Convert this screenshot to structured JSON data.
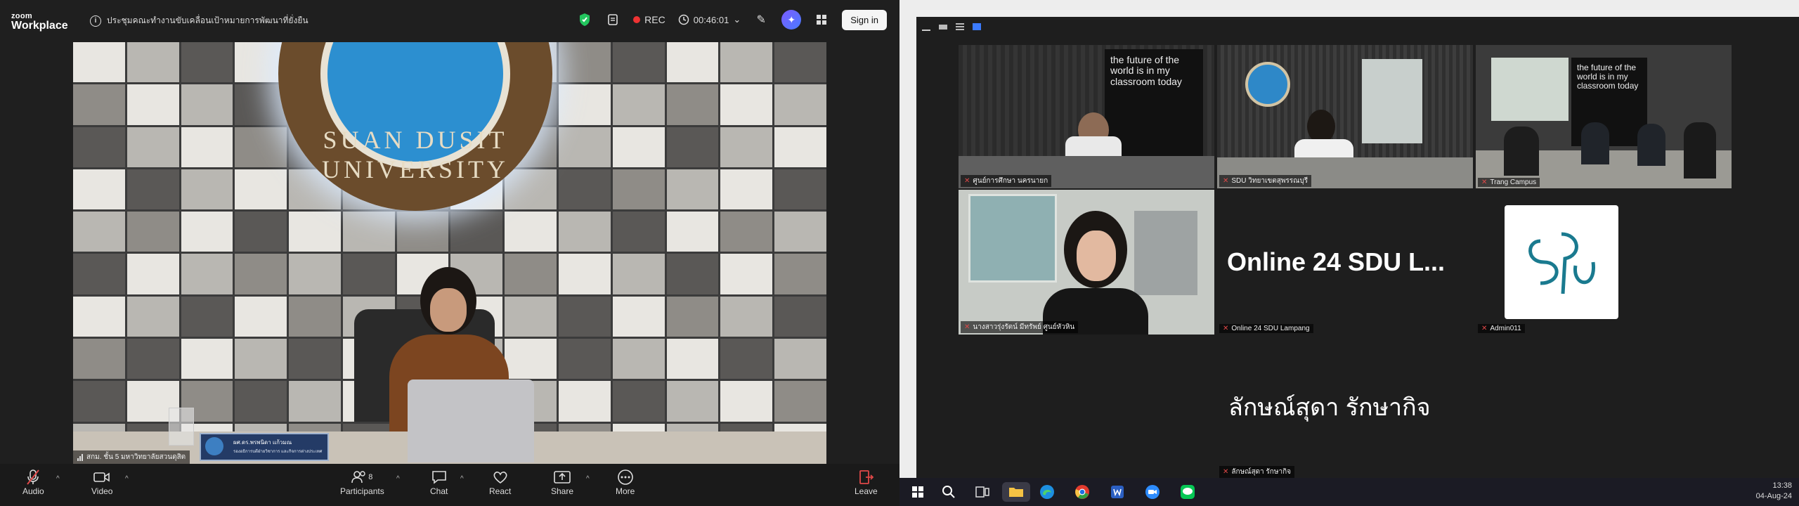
{
  "zoom": {
    "brand_top": "zoom",
    "brand_bottom": "Workplace",
    "meeting_title": "ประชุมคณะทำงานขับเคลื่อนเป้าหมายการพัฒนาที่ยั่งยืน",
    "rec_label": "REC",
    "timer": "00:46:01",
    "signin_label": "Sign in",
    "main_video": {
      "emblem_text": "SUAN DUSIT UNIVERSITY",
      "participant_name": "สกม. ชั้น 5 มหาวิทยาลัยสวนดุสิต",
      "namecard_line1": "ผศ.ดร.พรพนิดา แก้วมณ",
      "namecard_line2": "รองอธิการบดีฝ่ายวิชาการ และกิจการต่างประเทศ"
    },
    "toolbar": {
      "audio": "Audio",
      "video": "Video",
      "participants": "Participants",
      "participants_count": "8",
      "chat": "Chat",
      "react": "React",
      "share": "Share",
      "more": "More",
      "leave": "Leave"
    }
  },
  "gallery": {
    "tiles": [
      {
        "label": "ศูนย์การศึกษา นครนายก",
        "board_text": "the future of the world is in my classroom today"
      },
      {
        "label": "SDU วิทยาเขตสุพรรณบุรี"
      },
      {
        "label": "Trang Campus",
        "board_text": "the future of the world is in my classroom today"
      },
      {
        "label": "นางสาวรุ่งรัตน์ มีทรัพย์ ศูนย์หัวหิน"
      },
      {
        "label": "Online 24 SDU Lampang",
        "big_name": "Online 24 SDU L..."
      },
      {
        "label": "Admin011",
        "avatar_text": "SDU"
      },
      {
        "label": "ลักษณ์สุดา รักษากิจ",
        "big_name": "ลักษณ์สุดา รักษากิจ"
      }
    ]
  },
  "taskbar": {
    "time": "13:38",
    "date": "04-Aug-24",
    "icons": [
      "windows-icon",
      "search-icon",
      "task-view-icon",
      "file-explorer-icon",
      "edge-icon",
      "chrome-icon",
      "word-icon",
      "zoom-icon",
      "line-icon"
    ]
  }
}
